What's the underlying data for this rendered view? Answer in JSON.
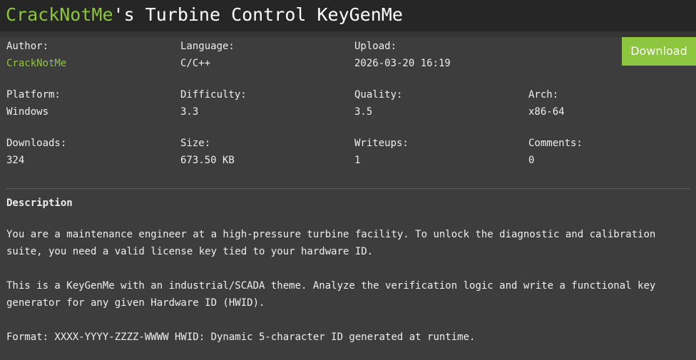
{
  "header": {
    "title_author": "CrackNotMe",
    "title_rest": "'s Turbine Control KeyGenMe"
  },
  "meta": {
    "author_label": "Author:",
    "author_value": "CrackNotMe",
    "language_label": "Language:",
    "language_value": "C/C++",
    "upload_label": "Upload:",
    "upload_value": "2026-03-20 16:19",
    "platform_label": "Platform:",
    "platform_value": "Windows",
    "difficulty_label": "Difficulty:",
    "difficulty_value": "3.3",
    "quality_label": "Quality:",
    "quality_value": "3.5",
    "arch_label": "Arch:",
    "arch_value": "x86-64",
    "downloads_label": "Downloads:",
    "downloads_value": "324",
    "size_label": "Size:",
    "size_value": "673.50 KB",
    "writeups_label": "Writeups:",
    "writeups_value": "1",
    "comments_label": "Comments:",
    "comments_value": "0"
  },
  "download": {
    "label": "Download"
  },
  "description": {
    "heading": "Description",
    "paragraphs": [
      "You are a maintenance engineer at a high-pressure turbine facility. To unlock the diagnostic and calibration suite, you need a valid license key tied to your hardware ID.",
      "This is a KeyGenMe with an industrial/SCADA theme. Analyze the verification logic and write a functional key generator for any given Hardware ID (HWID).",
      "Format: XXXX-YYYY-ZZZZ-WWWW HWID: Dynamic 5-character ID generated at runtime."
    ]
  },
  "colors": {
    "accent": "#8cc63f",
    "title_bg": "#262626",
    "panel_bg": "#3d3d3d",
    "page_bg": "#353535"
  }
}
